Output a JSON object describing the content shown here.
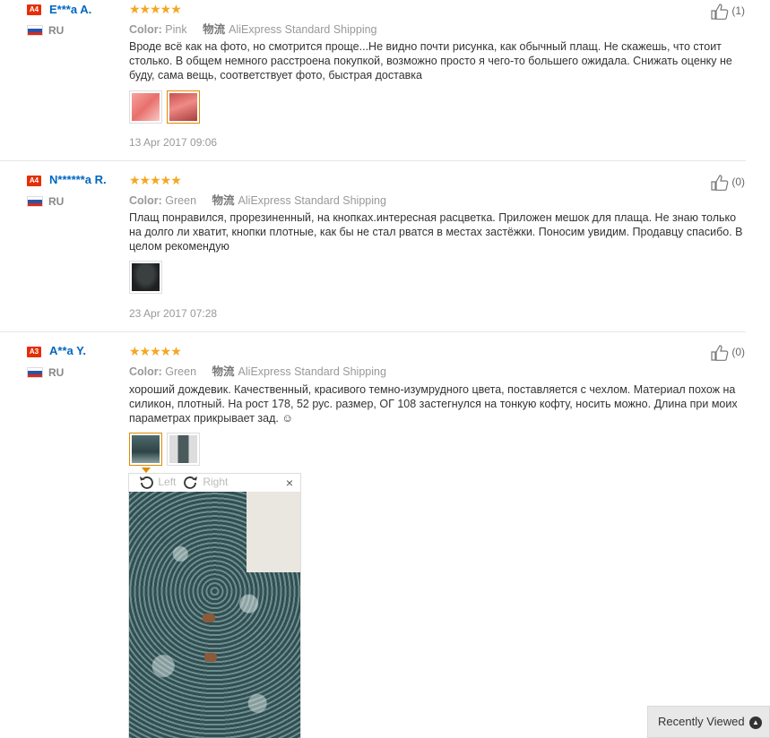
{
  "reviews": [
    {
      "level": "A4",
      "name": "E***a A.",
      "country": "RU",
      "stars": "★★★★★",
      "color_label": "Color:",
      "color_value": "Pink",
      "ship_icon": "物流",
      "shipping": "AliExpress Standard Shipping",
      "text": "Вроде всё как на фото, но смотрится проще...Не видно почти рисунка, как обычный плащ. Не скажешь, что стоит столько. В общем немного расстроена покупкой, возможно просто я чего-то большего ожидала. Снижать оценку не буду, сама вещь, соответствует фото, быстрая доставка",
      "date": "13 Apr 2017 09:06",
      "helpful": "(1)"
    },
    {
      "level": "A4",
      "name": "N******a R.",
      "country": "RU",
      "stars": "★★★★★",
      "color_label": "Color:",
      "color_value": "Green",
      "ship_icon": "物流",
      "shipping": "AliExpress Standard Shipping",
      "text": "Плащ понравился, прорезиненный, на кнопках.интересная расцветка. Приложен мешок для плаща. Не знаю только на долго ли хватит, кнопки плотные, как бы не стал рватся в местах застёжки. Поносим увидим. Продавцу спасибо. В целом рекомендую",
      "date": "23 Apr 2017 07:28",
      "helpful": "(0)"
    },
    {
      "level": "A3",
      "name": "A**a Y.",
      "country": "RU",
      "stars": "★★★★★",
      "color_label": "Color:",
      "color_value": "Green",
      "ship_icon": "物流",
      "shipping": "AliExpress Standard Shipping",
      "text": "хороший дождевик. Качественный, красивого темно-изумрудного цвета, поставляется с чехлом. Материал похож на силикон, плотный. На рост 178, 52 рус. размер, ОГ 108 застегнулся на тонкую кофту, носить можно. Длина при моих параметрах прикрывает зад. ☺",
      "helpful": "(0)"
    }
  ],
  "viewer": {
    "rotate_left": "Left",
    "rotate_right": "Right",
    "close": "×"
  },
  "recently_viewed": "Recently Viewed",
  "colors": {
    "link": "#0066c0",
    "badge": "#e62e04",
    "star": "#f5a623",
    "active_thumb": "#e08a00"
  },
  "icons": [
    "thumbs-up-icon",
    "rotate-left-icon",
    "rotate-right-icon",
    "close-icon",
    "chevron-up-icon",
    "russia-flag-icon"
  ]
}
